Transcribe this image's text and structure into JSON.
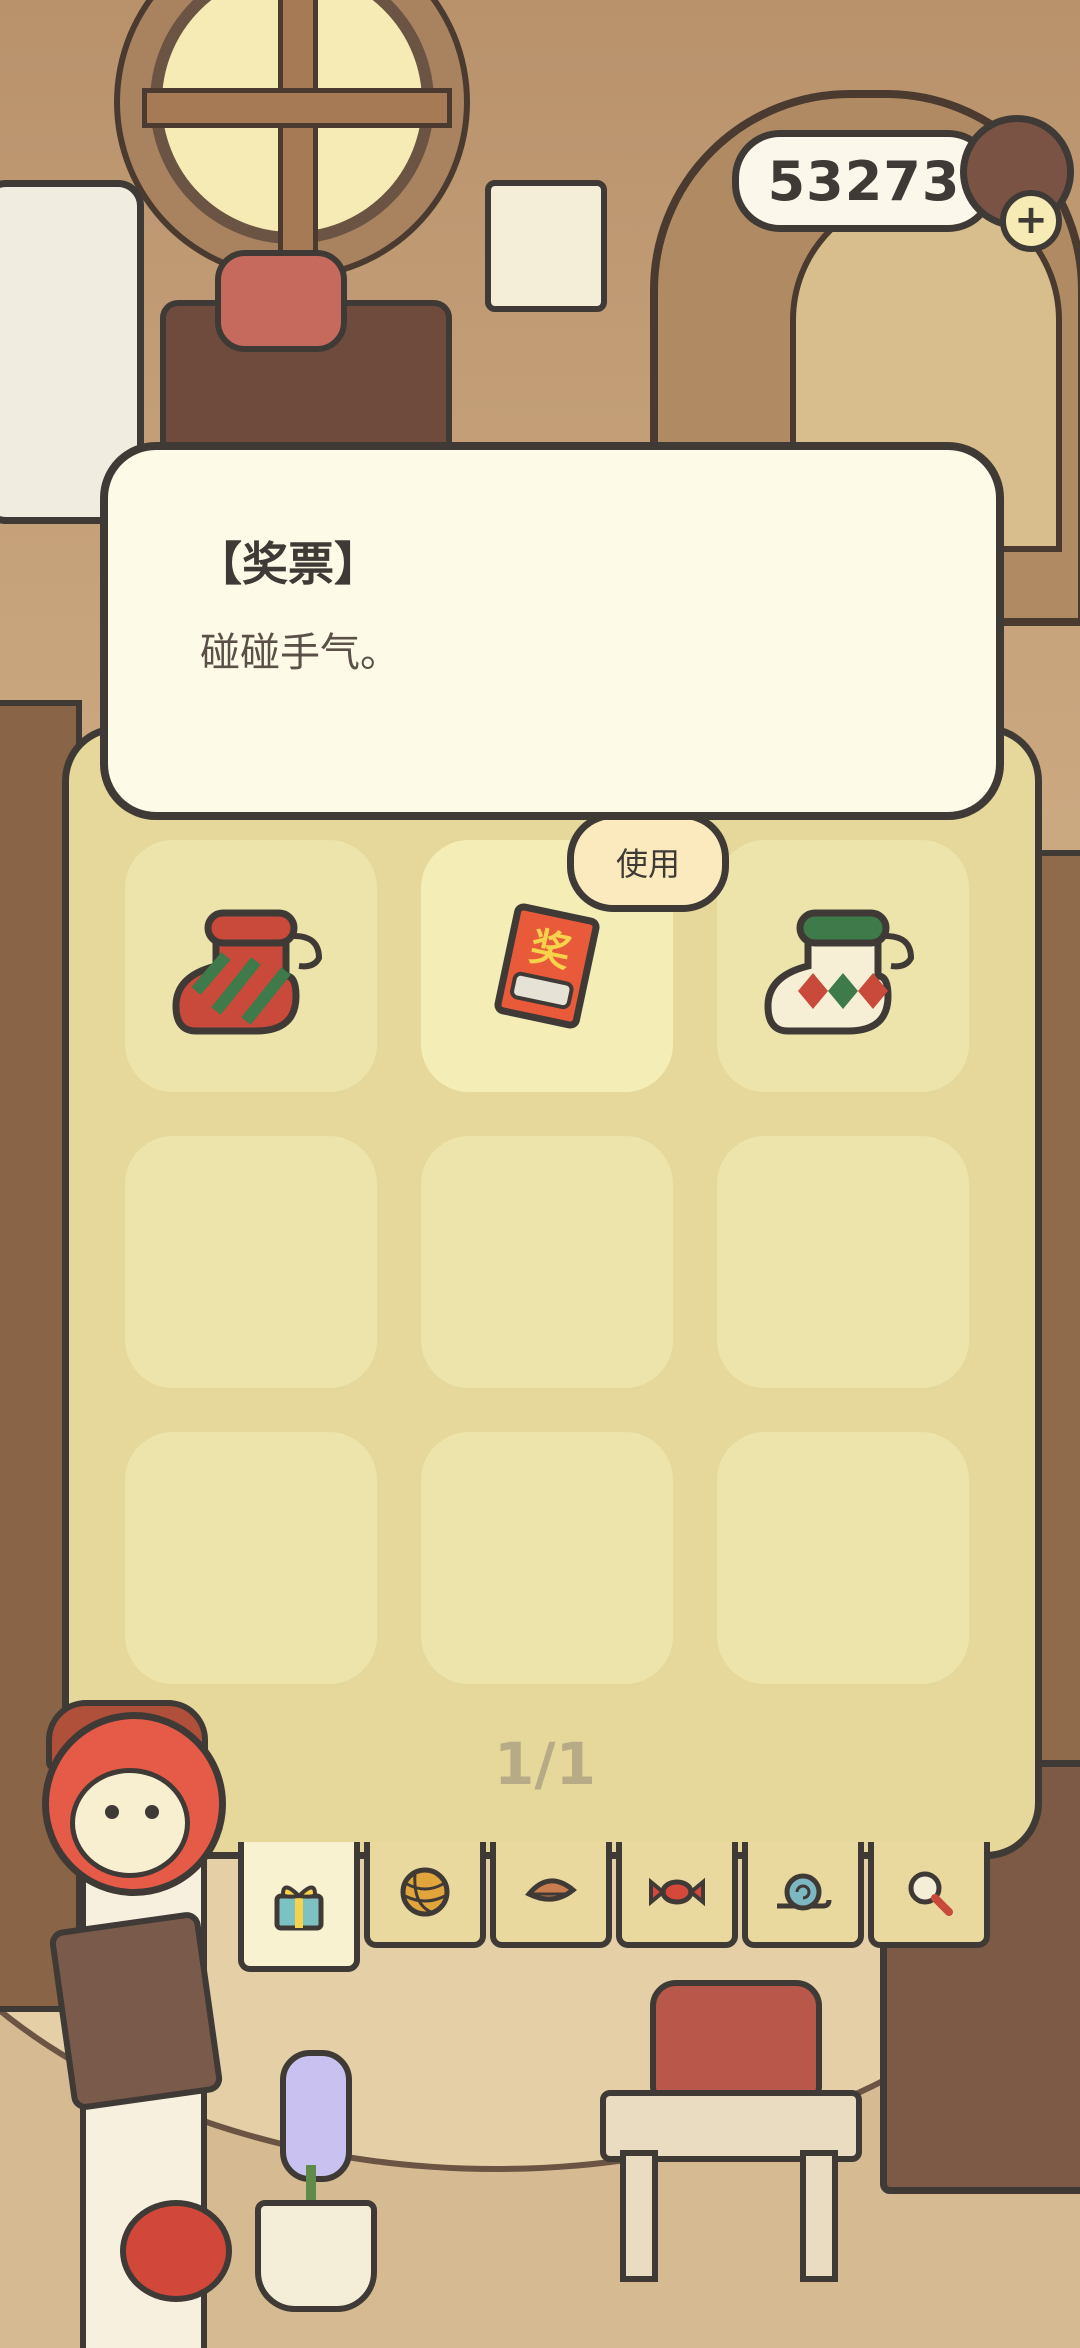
{
  "coins": {
    "amount": "53273",
    "plus_icon": "plus-icon"
  },
  "dialog": {
    "title": "【奖票】",
    "description": "碰碰手气。"
  },
  "inventory": {
    "use_label": "使用",
    "page_indicator": "1/1",
    "slots": [
      {
        "item": "striped-sock-icon",
        "selected": false
      },
      {
        "item": "lottery-ticket-icon",
        "selected": true
      },
      {
        "item": "diamond-sock-icon",
        "selected": false
      },
      {
        "item": "",
        "selected": false
      },
      {
        "item": "",
        "selected": false
      },
      {
        "item": "",
        "selected": false
      },
      {
        "item": "",
        "selected": false
      },
      {
        "item": "",
        "selected": false
      },
      {
        "item": "",
        "selected": false
      }
    ]
  },
  "tabs": [
    {
      "icon": "gift-icon",
      "active": true
    },
    {
      "icon": "yarn-ball-icon",
      "active": false
    },
    {
      "icon": "leaf-icon",
      "active": false
    },
    {
      "icon": "candy-icon",
      "active": false
    },
    {
      "icon": "snail-icon",
      "active": false
    },
    {
      "icon": "magnifier-icon",
      "active": false
    }
  ],
  "colors": {
    "panel": "#e6d89a",
    "slot": "#ece4aa",
    "dialog": "#fdfbe8",
    "outline": "#3f3a36"
  }
}
